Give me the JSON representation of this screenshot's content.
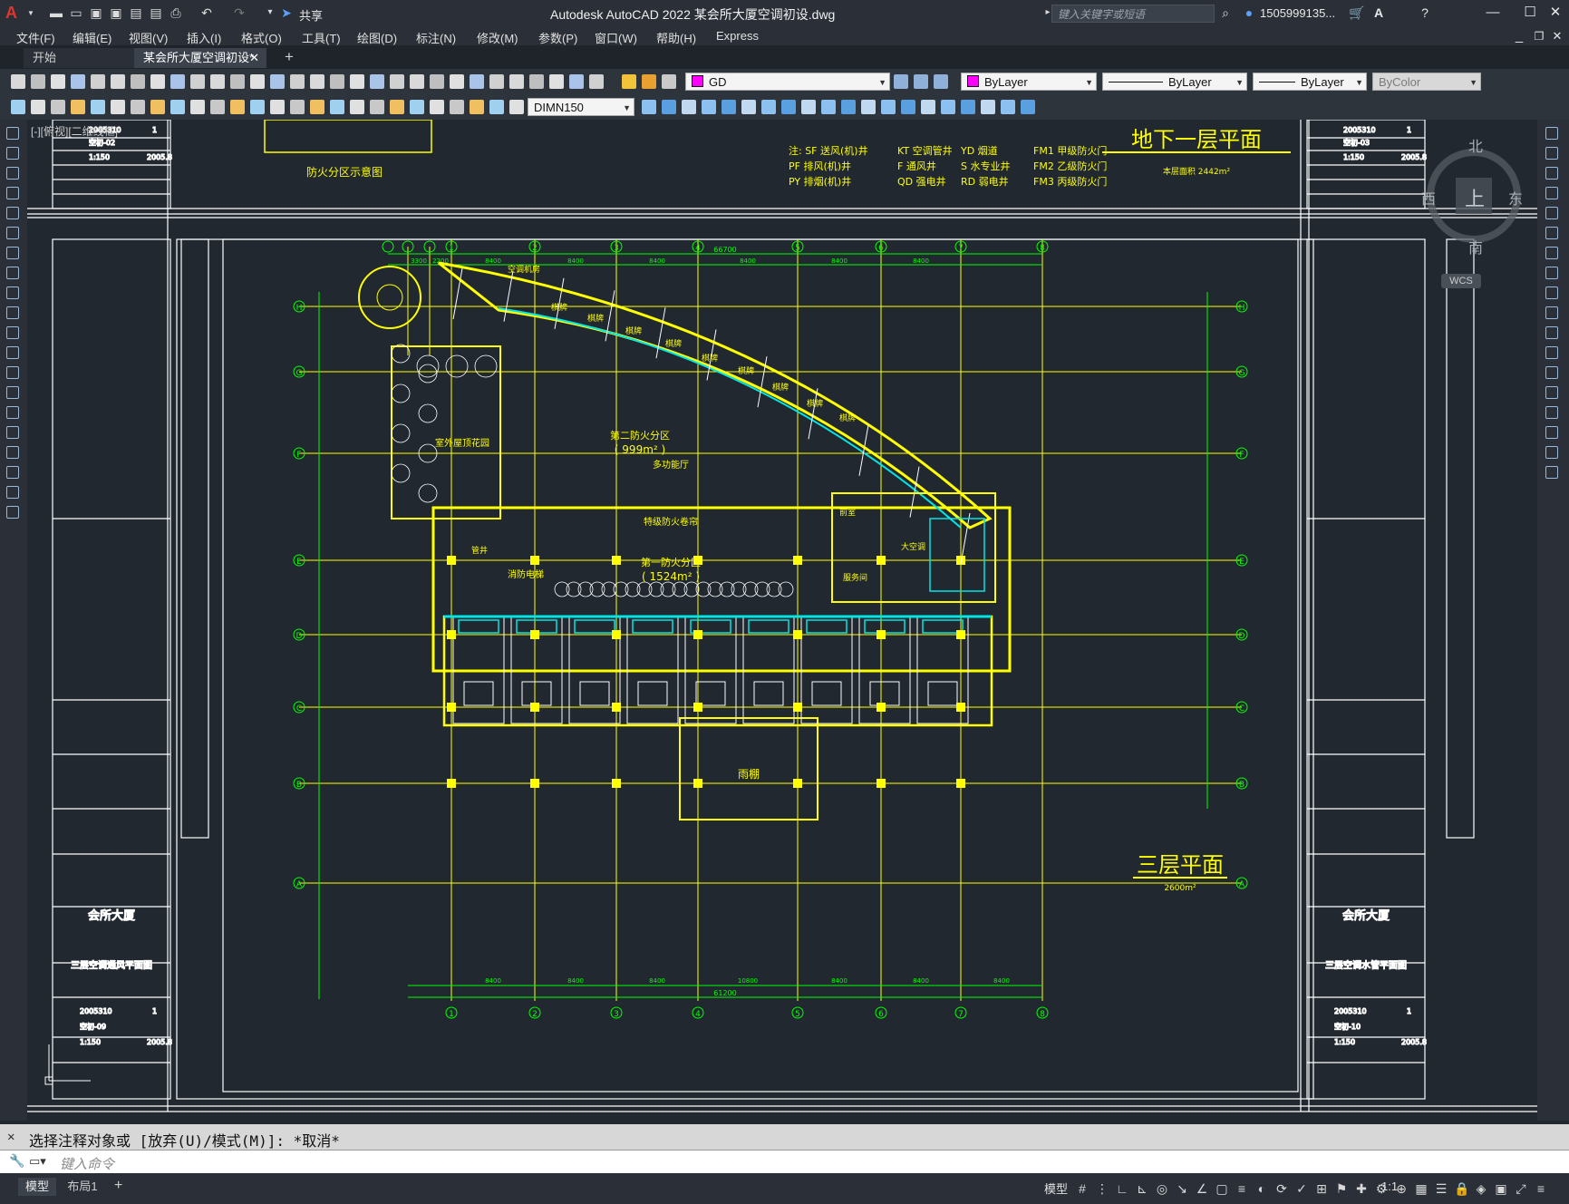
{
  "app": {
    "title": "Autodesk AutoCAD 2022    某会所大厦空调初设.dwg",
    "share_label": "共享",
    "search_placeholder": "键入关键字或短语",
    "user": "1505999135...",
    "a360": "A"
  },
  "menu": [
    "文件(F)",
    "编辑(E)",
    "视图(V)",
    "插入(I)",
    "格式(O)",
    "工具(T)",
    "绘图(D)",
    "标注(N)",
    "修改(M)",
    "参数(P)",
    "窗口(W)",
    "帮助(H)",
    "Express"
  ],
  "tabs": [
    {
      "label": "开始"
    },
    {
      "label": "某会所大厦空调初设*"
    }
  ],
  "toolbar": {
    "layer_value": "GD",
    "color_value": "ByLayer",
    "linetype_value": "ByLayer",
    "lineweight_value": "ByLayer",
    "plotstyle_value": "ByColor",
    "dimstyle_value": "DIMN150"
  },
  "viewcube": {
    "north": "北",
    "south": "南",
    "east": "东",
    "west": "西",
    "top": "上",
    "wcs": "WCS"
  },
  "drawing": {
    "viewport_label": "[-][俯视][二维线框]",
    "title_upper": "地下一层平面",
    "title_upper_sub": "本层面积  2442m²",
    "title_lower": "三层平面",
    "title_lower_sub": "2600m²",
    "fire_zone_title": "防火分区示意图",
    "legend": [
      [
        "注: SF 送风(机)井",
        "KT 空调管井",
        "YD 烟道",
        "FM1 甲级防火门"
      ],
      [
        "PF 排风(机)井",
        "F 通风井",
        "S 水专业井",
        "FM2 乙级防火门"
      ],
      [
        "PY 排烟(机)井",
        "QD 强电井",
        "RD 弱电井",
        "FM3 丙级防火门"
      ]
    ],
    "rooms": {
      "zone2": "第二防火分区",
      "zone2_area": "( 999m² )",
      "zone1": "第一防火分区",
      "zone1_area": "( 1524m² )",
      "multi": "多功能厅",
      "roof_garden": "室外屋顶花园",
      "ac_room": "空调机房",
      "fire_elev": "消防电梯",
      "corridor": "特级防火卷帘",
      "ac_room2": "大空调",
      "chess": "棋牌",
      "pipe": "管井",
      "podium": "雨棚",
      "office": "服务间",
      "sub": "前室"
    },
    "grid_numbers": [
      "1",
      "2",
      "3",
      "4",
      "5",
      "6",
      "7",
      "8"
    ],
    "grid_letters": [
      "H",
      "G",
      "F",
      "E",
      "D",
      "C",
      "B",
      "A"
    ],
    "dims_top": [
      "3300",
      "2200",
      "8400",
      "8400",
      "8400",
      "8400",
      "8400",
      "8400"
    ],
    "dim_total_top": "66700",
    "dims_bottom": [
      "8400",
      "8400",
      "8400",
      "10800",
      "8400",
      "8400",
      "8400"
    ],
    "dim_total_bottom": "61200",
    "titleblock_left": {
      "company": "会所大厦",
      "drawing_name": "三层空调通风平面图",
      "number": "2005310",
      "sheet": "空初-09",
      "scale": "1:150",
      "date": "2005.8",
      "page": "1"
    },
    "titleblock_right": {
      "company": "会所大厦",
      "drawing_name": "三层空调水管平面图",
      "number": "2005310",
      "sheet": "空初-10",
      "scale": "1:150",
      "date": "2005.8",
      "page": "1"
    },
    "titleblock_top_left": {
      "number": "2005310",
      "sheet": "空初-02",
      "scale": "1:150",
      "date": "2005.8",
      "page": "1"
    },
    "titleblock_top_right": {
      "number": "2005310",
      "sheet": "空初-03",
      "scale": "1:150",
      "date": "2005.8",
      "page": "1"
    }
  },
  "command": {
    "history": "选择注释对象或 [放弃(U)/模式(M)]: *取消*",
    "placeholder": "键入命令"
  },
  "status": {
    "model_tab": "模型",
    "layout_tab": "布局1",
    "model_label": "模型",
    "scale": "1:1"
  },
  "colors": {
    "yellow": "#ffff00",
    "cyan": "#00e5e5",
    "green": "#00ff00",
    "magenta": "#ff00ff",
    "white": "#ffffff",
    "background": "#212830"
  }
}
